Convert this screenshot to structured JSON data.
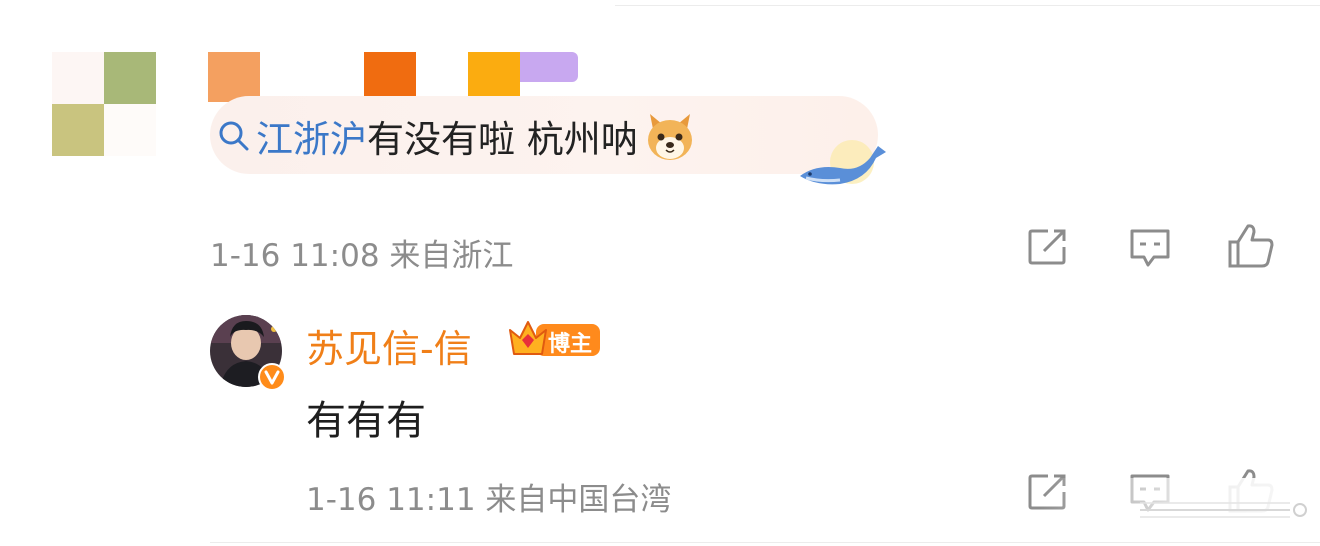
{
  "comment": {
    "topic": "江浙沪",
    "text": "有没有啦 杭州呐",
    "time": "1-16 11:08",
    "location": "来自浙江",
    "icons": [
      "search-icon",
      "dog-emoji-icon",
      "whale-icon",
      "share-icon",
      "comment-icon",
      "like-icon"
    ]
  },
  "reply": {
    "author": "苏见信-信",
    "badge": "博主",
    "text": "有有有",
    "time": "1-16 11:11",
    "location": "来自中国台湾",
    "icons": [
      "avatar",
      "verified-v-icon",
      "crown-badge-icon",
      "share-icon",
      "comment-icon",
      "like-icon"
    ]
  },
  "colors": {
    "topic_link": "#3b78c8",
    "author_name": "#f07f18",
    "meta_text": "#8c8c8c",
    "bubble": "#fbf0ec",
    "mosaic": [
      "#a8b878",
      "#c9c47f",
      "#fdf6f4",
      "#fefbf9"
    ],
    "name_blocks": [
      "#f4a060",
      "#f06c10",
      "#fbac10",
      "#c8a8f0"
    ]
  }
}
